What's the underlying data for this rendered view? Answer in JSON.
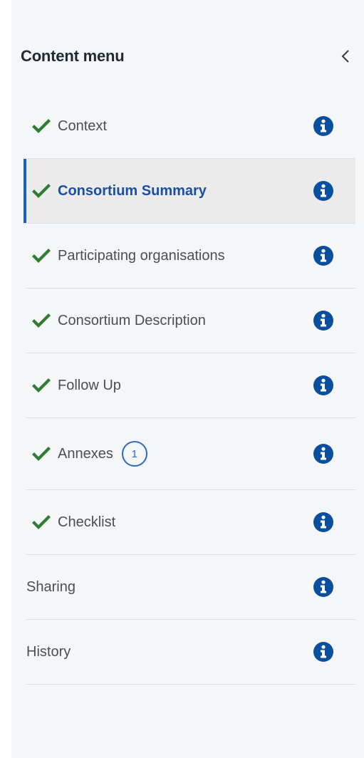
{
  "panel": {
    "title": "Content menu",
    "collapse_icon": "chevron-left-icon"
  },
  "colors": {
    "check": "#2e7d32",
    "info": "#0a4f9e",
    "active_accent": "#1565c0",
    "active_text": "#1b4fa0",
    "badge": "#2a6bc2"
  },
  "menu": {
    "items": [
      {
        "label": "Context",
        "completed": true,
        "active": false
      },
      {
        "label": "Consortium Summary",
        "completed": true,
        "active": true
      },
      {
        "label": "Participating organisations",
        "completed": true,
        "active": false
      },
      {
        "label": "Consortium Description",
        "completed": true,
        "active": false
      },
      {
        "label": "Follow Up",
        "completed": true,
        "active": false
      },
      {
        "label": "Annexes",
        "completed": true,
        "active": false,
        "badge": "1"
      },
      {
        "label": "Checklist",
        "completed": true,
        "active": false
      },
      {
        "label": "Sharing",
        "completed": false,
        "active": false
      },
      {
        "label": "History",
        "completed": false,
        "active": false
      }
    ]
  }
}
